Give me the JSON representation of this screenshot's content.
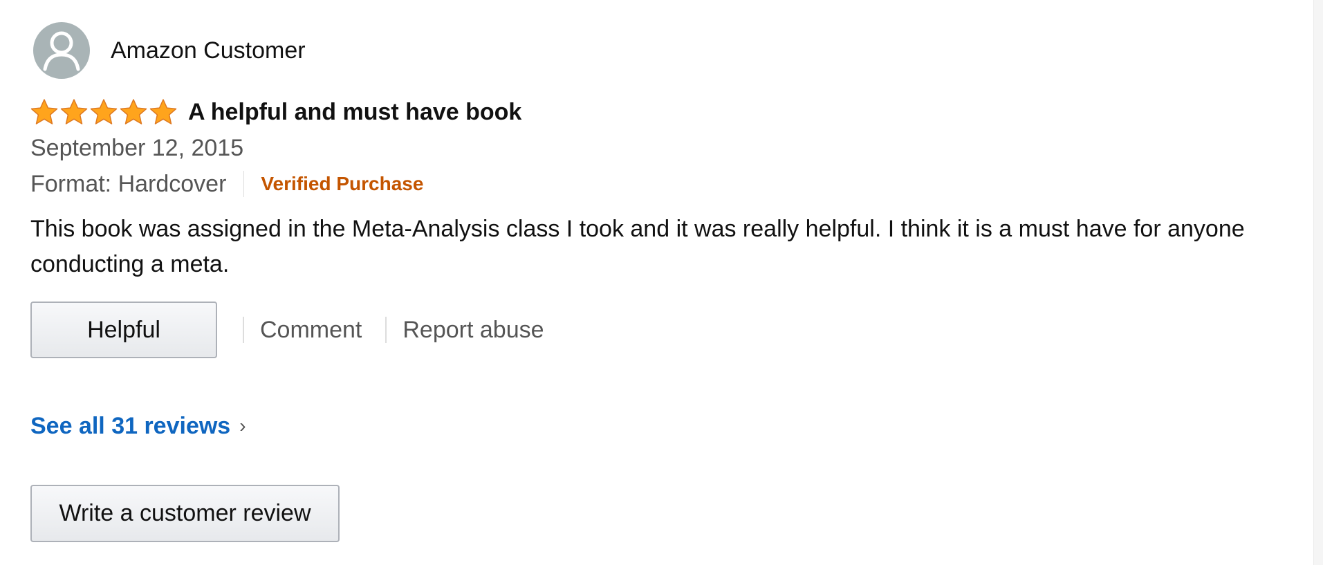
{
  "reviewer": {
    "name": "Amazon Customer",
    "avatar_icon": "default-user-avatar-icon",
    "avatar_color": "#a9b4b6"
  },
  "review": {
    "rating": 5,
    "rating_max": 5,
    "star_icon": "star-icon",
    "star_color": "#ffa41c",
    "title": "A helpful and must have book",
    "date": "September 12, 2015",
    "format": "Format: Hardcover",
    "verified_label": "Verified Purchase",
    "verified_color": "#c45500",
    "body": "This book was assigned in the Meta-Analysis class I took and it was really helpful. I think it is a must have for anyone conducting a meta."
  },
  "actions": {
    "helpful_label": "Helpful",
    "comment_label": "Comment",
    "report_label": "Report abuse"
  },
  "footer": {
    "see_all_label": "See all 31 reviews",
    "see_all_chevron": "›",
    "link_color": "#0f66c0",
    "write_review_label": "Write a customer review"
  }
}
